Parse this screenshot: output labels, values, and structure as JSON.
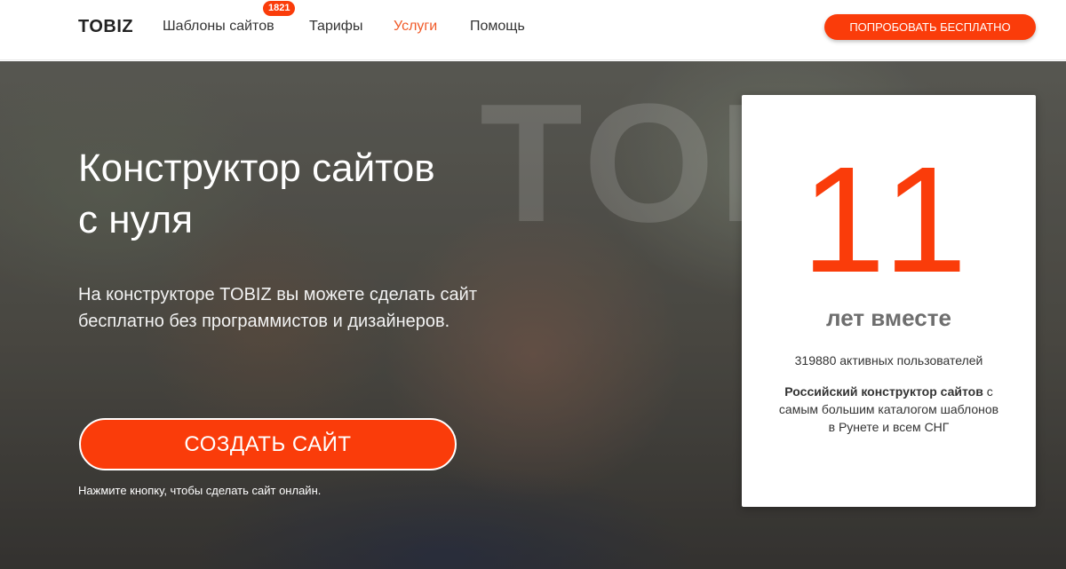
{
  "header": {
    "logo": "TOBIZ",
    "nav": [
      {
        "label": "Шаблоны сайтов",
        "badge": "1821"
      },
      {
        "label": "Тарифы"
      },
      {
        "label": "Услуги",
        "active": true
      },
      {
        "label": "Помощь"
      }
    ],
    "cta_label": "ПОПРОБОВАТЬ БЕСПЛАТНО"
  },
  "hero": {
    "watermark": "TOBIZ",
    "title_line1": "Конструктор сайтов",
    "title_line2": "с нуля",
    "text": "На конструкторе TOBIZ вы можете сделать сайт бесплатно без программистов и дизайнеров.",
    "button_label": "СОЗДАТЬ САЙТ",
    "hint": "Нажмите кнопку, чтобы сделать сайт онлайн."
  },
  "stats": {
    "number": "11",
    "years_label": "лет вместе",
    "users": "319880 активных пользователей",
    "desc_bold": "Российский конструктор сайтов",
    "desc_rest": " с самым большим каталогом шаблонов в Рунете и всем СНГ"
  },
  "colors": {
    "accent": "#fa3c0a",
    "nav_active": "#f05a28"
  }
}
